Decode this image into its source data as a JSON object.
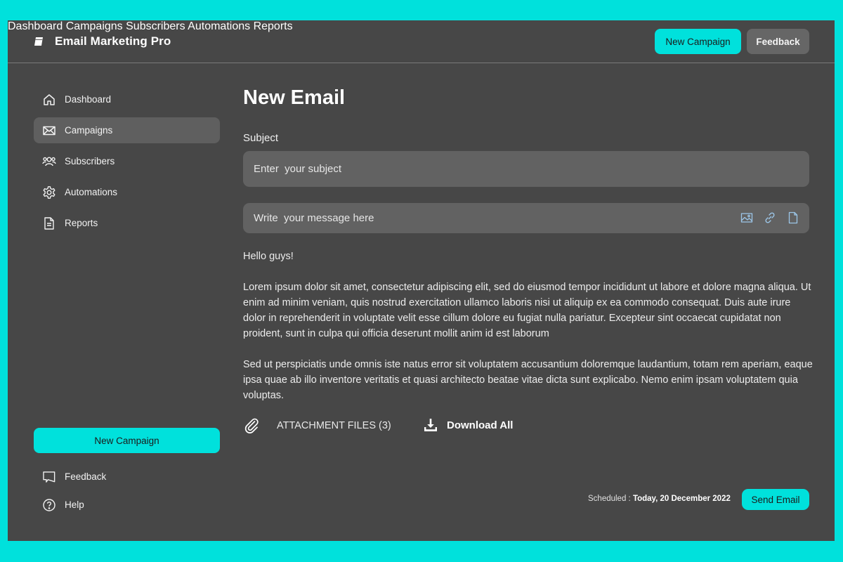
{
  "app": {
    "title": "Email Marketing Pro"
  },
  "topnav": {
    "links": [
      "Dashboard",
      "Campaigns",
      "Subscribers",
      "Automations",
      "Reports"
    ],
    "new_campaign": "New Campaign",
    "feedback": "Feedback"
  },
  "sidebar": {
    "items": [
      {
        "label": "Dashboard",
        "icon": "home-icon"
      },
      {
        "label": "Campaigns",
        "icon": "envelope-icon",
        "active": true
      },
      {
        "label": "Subscribers",
        "icon": "users-icon"
      },
      {
        "label": "Automations",
        "icon": "gear-icon"
      },
      {
        "label": "Reports",
        "icon": "document-icon"
      }
    ],
    "new_campaign": "New Campaign",
    "feedback": "Feedback",
    "help": "Help"
  },
  "main": {
    "title": "New Email",
    "subject_label": "Subject",
    "subject_placeholder": "Enter  your subject",
    "message_placeholder": "Write  your message here",
    "greeting": "Hello guys!",
    "paragraph1": "Lorem ipsum dolor sit amet, consectetur adipiscing elit, sed do eiusmod tempor incididunt ut labore et dolore magna aliqua. Ut enim ad minim veniam, quis nostrud exercitation ullamco laboris nisi ut aliquip ex ea commodo consequat. Duis aute irure dolor in reprehenderit in voluptate velit esse cillum dolore eu fugiat nulla pariatur. Excepteur sint occaecat cupidatat non proident, sunt in culpa qui officia deserunt mollit anim id est laborum",
    "paragraph2": "Sed ut perspiciatis unde omnis iste natus error sit voluptatem accusantium doloremque laudantium, totam rem aperiam, eaque ipsa quae ab illo inventore veritatis et quasi architecto beatae vitae dicta sunt explicabo. Nemo enim ipsam voluptatem quia voluptas.",
    "attachments_label": "ATTACHMENT FILES (3)",
    "download_all": "Download All",
    "scheduled_label": "Scheduled : ",
    "scheduled_value": "Today, 20 December 2022",
    "send_button": "Send Email"
  },
  "colors": {
    "accent": "#00e1dc",
    "panel": "#474747",
    "input": "#626262",
    "active_item": "#5f5f5f",
    "toolbar_icon": "#9cc6e8"
  }
}
